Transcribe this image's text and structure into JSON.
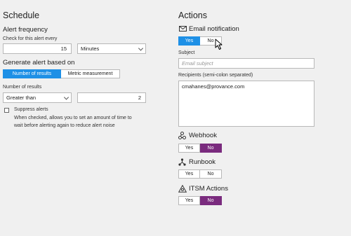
{
  "schedule": {
    "title": "Schedule",
    "alert_frequency_label": "Alert frequency",
    "check_every_label": "Check for this alert every",
    "frequency_value": "15",
    "frequency_unit": "Minutes"
  },
  "generate": {
    "title": "Generate alert based on",
    "options": [
      "Number of results",
      "Metric measurement"
    ],
    "selected": "Number of results",
    "number_of_results_label": "Number of results",
    "operator": "Greater than",
    "threshold": "2"
  },
  "suppress": {
    "label": "Suppress alerts",
    "description_line1": "When checked, allows you to set an amount of time to",
    "description_line2": "wait before alerting again to reduce alert noise",
    "checked": false
  },
  "actions": {
    "title": "Actions",
    "email": {
      "label": "Email notification",
      "icon": "envelope-icon",
      "yes": "Yes",
      "no": "No",
      "selected": "Yes",
      "subject_label": "Subject",
      "subject_placeholder": "Email subject",
      "recipients_label": "Recipients (semi-colon separated)",
      "recipients_value": "cmahanes@provance.com"
    },
    "webhook": {
      "label": "Webhook",
      "icon": "webhook-icon",
      "yes": "Yes",
      "no": "No",
      "selected": "No"
    },
    "runbook": {
      "label": "Runbook",
      "icon": "runbook-icon",
      "yes": "Yes",
      "no": "No",
      "selected": "None"
    },
    "itsm": {
      "label": "ITSM Actions",
      "icon": "itsm-icon",
      "yes": "Yes",
      "no": "No",
      "selected": "No"
    }
  },
  "colors": {
    "background": "#f0f0f0",
    "selected_blue": "#1e90e6",
    "selected_purple": "#7a2b7e"
  }
}
